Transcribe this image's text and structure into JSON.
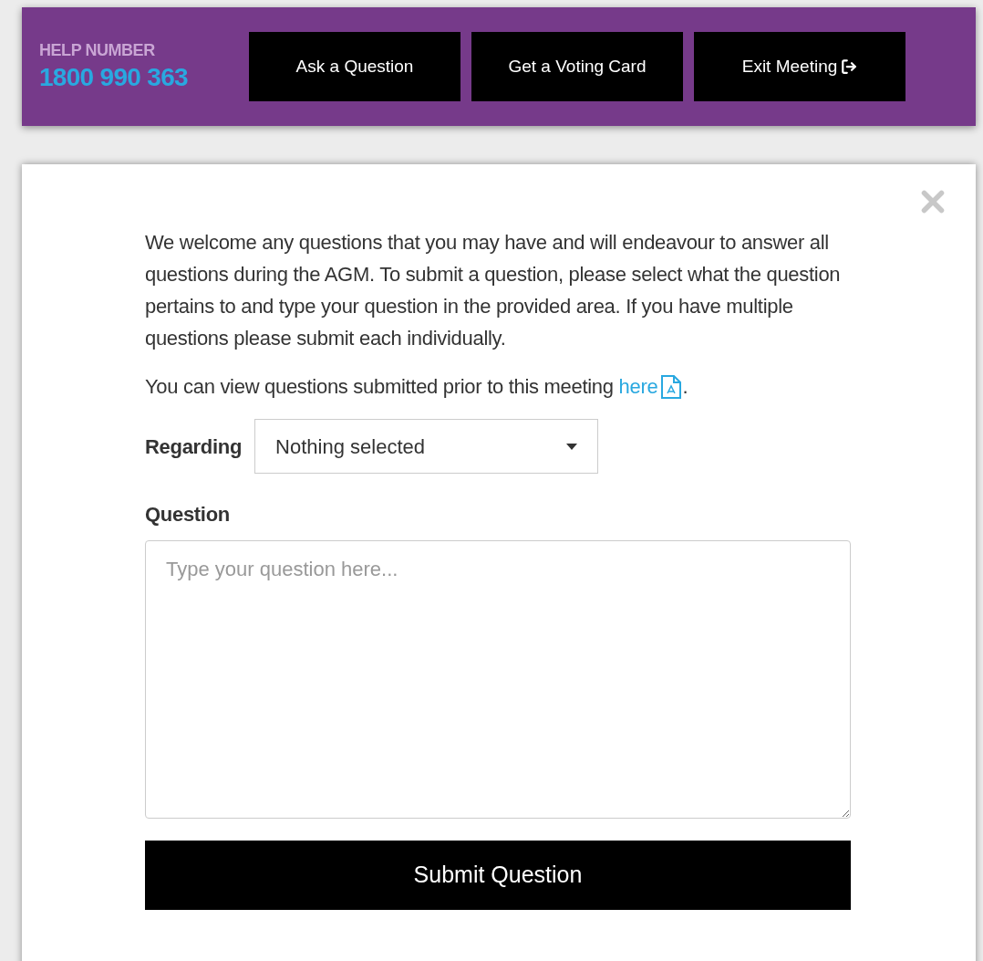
{
  "header": {
    "help_label": "HELP NUMBER",
    "help_number": "1800 990 363",
    "buttons": [
      {
        "label": "Ask a Question",
        "kind": "plain"
      },
      {
        "label": "Get a Voting Card",
        "kind": "plain"
      },
      {
        "label": "Exit Meeting",
        "kind": "exit"
      }
    ]
  },
  "dialog": {
    "intro": "We welcome any questions that you may have and will endeavour to answer all questions during the AGM. To submit a question, please select what the question pertains to and type your question in the provided area. If you have multiple questions please submit each individually.",
    "prior_text": "You can view questions submitted prior to this meeting",
    "prior_link": "here",
    "prior_suffix": ".",
    "regarding_label": "Regarding",
    "regarding_value": "Nothing selected",
    "question_label": "Question",
    "question_placeholder": "Type your question here...",
    "submit": "Submit Question"
  }
}
